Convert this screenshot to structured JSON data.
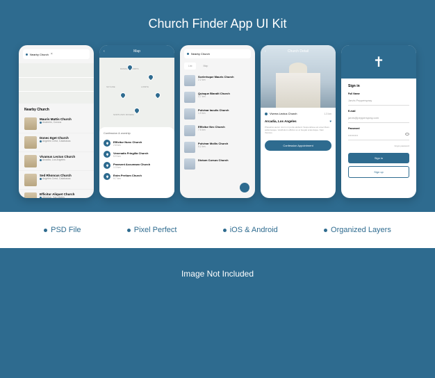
{
  "title": "Church Finder App UI Kit",
  "features": [
    "PSD File",
    "Pixel Perfect",
    "iOS & Android",
    "Organized Layers"
  ],
  "footer_note": "Image Not Included",
  "screen1": {
    "search_placeholder": "Nearby Church",
    "section_title": "Nearby Church",
    "items": [
      {
        "name": "Mauris Mattis Church",
        "meta": "Anaheim, Corona",
        "dist": "1.1 km"
      },
      {
        "name": "Donec Eget Church",
        "meta": "Angeles Crest, Calabasas",
        "dist": "2.3 km"
      },
      {
        "name": "Vivamus Lectus Church",
        "meta": "Arcadia, Los Angeles",
        "dist": "1.3 km"
      },
      {
        "name": "Sed Rhoncus Church",
        "meta": "Angeles Crest, Calabasas",
        "dist": ""
      },
      {
        "name": "Efficitur Aliquet Church",
        "meta": "Atherton, San Mateo",
        "dist": ""
      }
    ]
  },
  "screen2": {
    "title": "Map",
    "subtitle": "Confession & worship",
    "labels": [
      "RAMACHA LOMITA",
      "SKYLINE",
      "LOMITA",
      "NORTH BAY RIVIERA"
    ],
    "items": [
      {
        "name": "Efficitur Nunc Church",
        "dist": "2.8 km"
      },
      {
        "name": "Venenatis Fringilla Church",
        "dist": "5.9 km"
      },
      {
        "name": "Praesent Accumsan Church",
        "dist": "1.3 km"
      },
      {
        "name": "Enim Pretium Church",
        "dist": "9.7 km"
      }
    ]
  },
  "screen3": {
    "search_placeholder": "Nearby Church",
    "filters": [
      "List",
      "Map"
    ],
    "items": [
      {
        "name": "Scelerisque Mauris Church",
        "dist": "2.2 km"
      },
      {
        "name": "Quisque Blandit Church",
        "dist": "1.7 km"
      },
      {
        "name": "Pulvinar Iaculis Church",
        "dist": "1.9 km"
      },
      {
        "name": "Efficitur Nec Church",
        "dist": "7.5 km"
      },
      {
        "name": "Pulvinar Mollis Church",
        "dist": "5.2 km"
      },
      {
        "name": "Dictum Cursus Church",
        "dist": ""
      }
    ]
  },
  "screen4": {
    "title": "Church Detail",
    "location": "Viverra Lectus Church",
    "distance": "1.3 km",
    "city": "Arcadia, Los Angeles",
    "description": "Phasellus auctor nisi in mi porta eleifend. Suspendisse est amet libero pellentesque. Vestibulum efficitur ex et feugiat scelerisque. Nam rhoncus.",
    "cta": "Confession Appointment"
  },
  "screen5": {
    "title": "Sign in",
    "labels": {
      "name": "Full Name",
      "email": "E-mail",
      "password": "Password"
    },
    "values": {
      "name": "Jarvis Pepperspray",
      "email": "jarvis@pepperspray.com",
      "password": "••••••••••"
    },
    "forgot": "forgot password",
    "signin": "Sign in",
    "signup": "Sign up"
  }
}
